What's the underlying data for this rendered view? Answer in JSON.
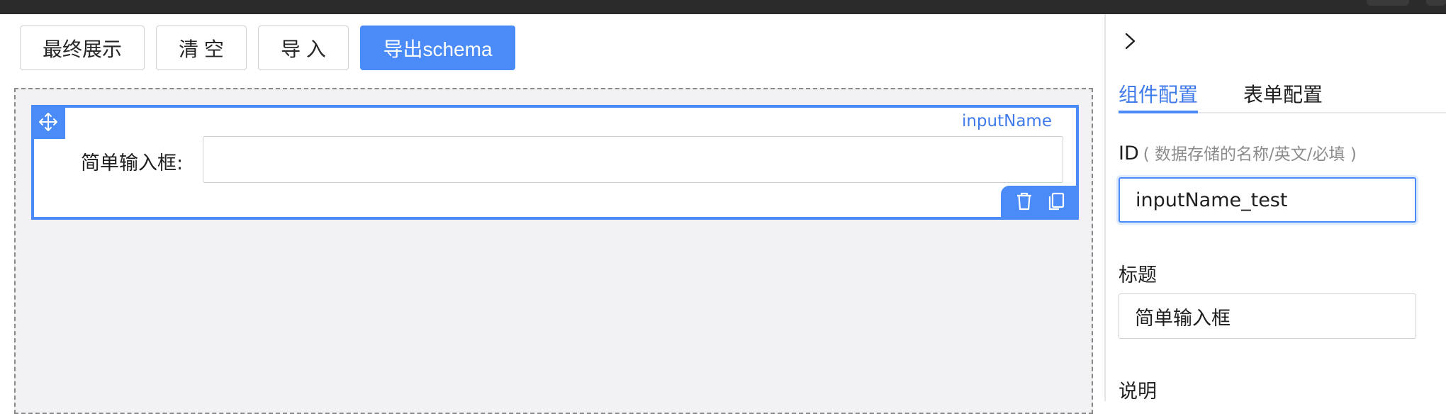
{
  "toolbar": {
    "buttons": [
      "最终展示",
      "清 空",
      "导 入",
      "导出schema"
    ]
  },
  "canvas": {
    "field": {
      "name_tag": "inputName",
      "label": "简单输入框:",
      "value": ""
    }
  },
  "panel": {
    "tabs": [
      "组件配置",
      "表单配置"
    ],
    "active_tab": "组件配置",
    "id_label": "ID",
    "id_hint": "( 数据存储的名称/英文/必填 )",
    "id_value": "inputName_test",
    "title_label": "标题",
    "title_value": "简单输入框",
    "desc_label": "说明"
  },
  "colors": {
    "primary": "#4a8bf7",
    "link": "#3f7bea",
    "canvas_bg": "#f2f2f4",
    "topbar": "#2b2b2b"
  },
  "icons": {
    "drag": "move-icon",
    "delete": "trash-icon",
    "copy": "copy-icon",
    "collapse": "chevron-right-icon"
  }
}
